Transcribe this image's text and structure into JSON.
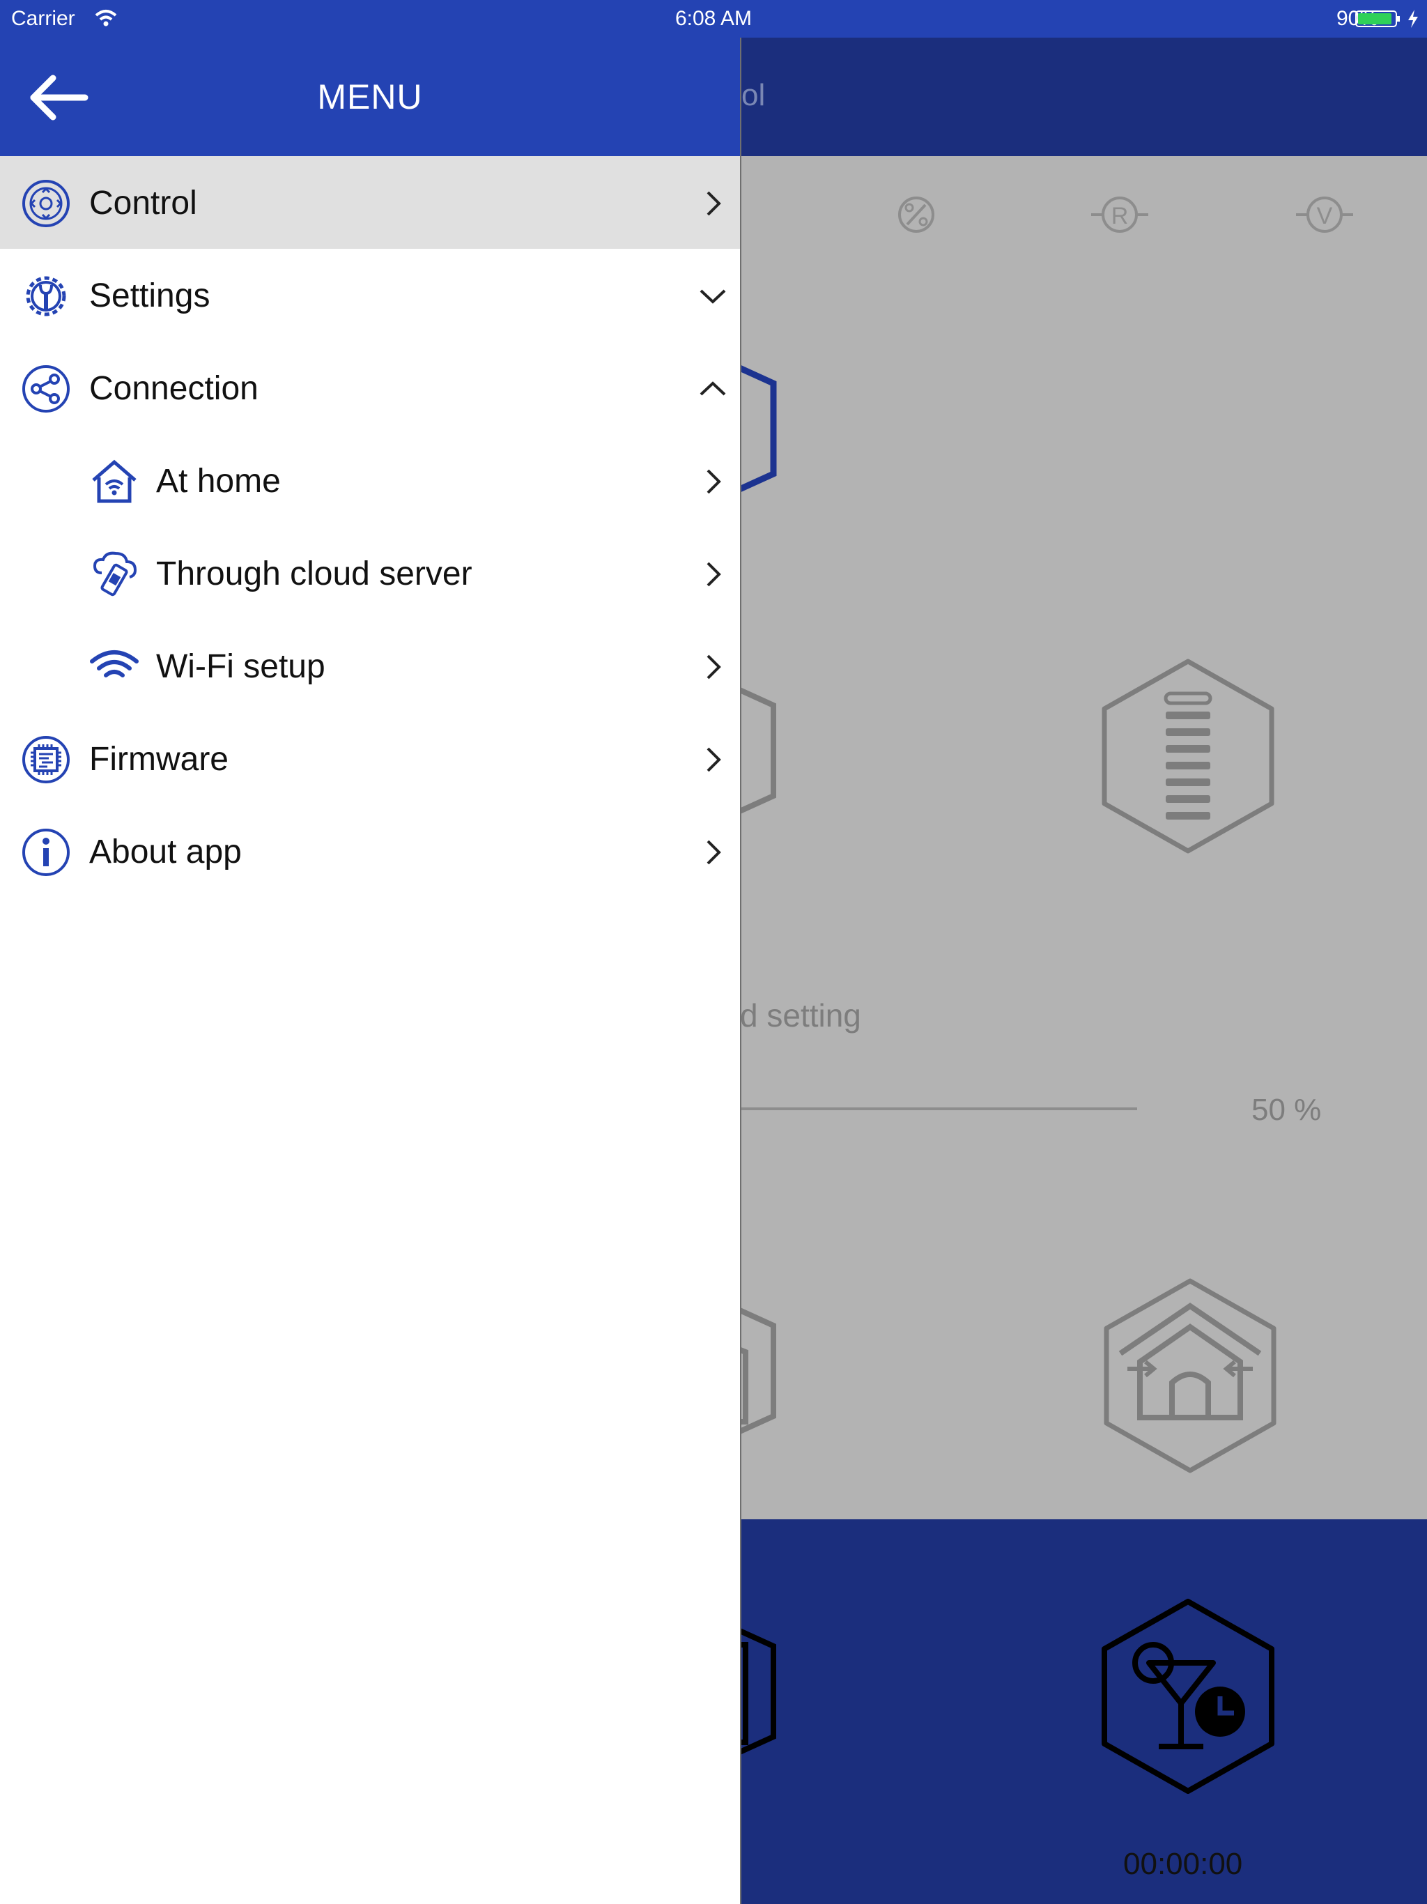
{
  "status_bar": {
    "carrier": "Carrier",
    "time": "6:08 AM",
    "battery": "90%",
    "icons": [
      "wifi-icon",
      "battery-icon",
      "charging-icon"
    ]
  },
  "drawer": {
    "title": "MENU",
    "back_icon": "arrow-left-icon",
    "items": [
      {
        "label": "Control",
        "icon": "control-dpad-icon",
        "chevron": "right",
        "selected": true,
        "level": 0
      },
      {
        "label": "Settings",
        "icon": "wrench-gear-icon",
        "chevron": "down",
        "level": 0
      },
      {
        "label": "Connection",
        "icon": "share-icon",
        "chevron": "up",
        "level": 0
      },
      {
        "label": "At home",
        "icon": "home-wifi-icon",
        "chevron": "right",
        "level": 1
      },
      {
        "label": "Through cloud server",
        "icon": "cloud-phone-icon",
        "chevron": "right",
        "level": 1
      },
      {
        "label": "Wi-Fi setup",
        "icon": "wifi-icon",
        "chevron": "right",
        "level": 1
      },
      {
        "label": "Firmware",
        "icon": "chip-icon",
        "chevron": "right",
        "level": 0
      },
      {
        "label": "About app",
        "icon": "info-icon",
        "chevron": "right",
        "level": 0
      }
    ]
  },
  "background_screen": {
    "title_fragment": "ol",
    "speed_label_fragment": "d setting",
    "speed_value": "50 %",
    "speed_fraction": 0.5,
    "timer": "00:00:00",
    "tab_icons": [
      "percent-icon",
      "r-icon",
      "v-icon"
    ],
    "tile_icons": [
      "fan-tile-icon",
      "level-bars-icon",
      "house-tile-icon",
      "party-timer-icon"
    ]
  },
  "colors": {
    "brand_blue": "#2443b3",
    "dim_blue": "#1b2e7d",
    "dim_gray": "#b3b3b3",
    "selected_row": "#e0e0e0"
  }
}
